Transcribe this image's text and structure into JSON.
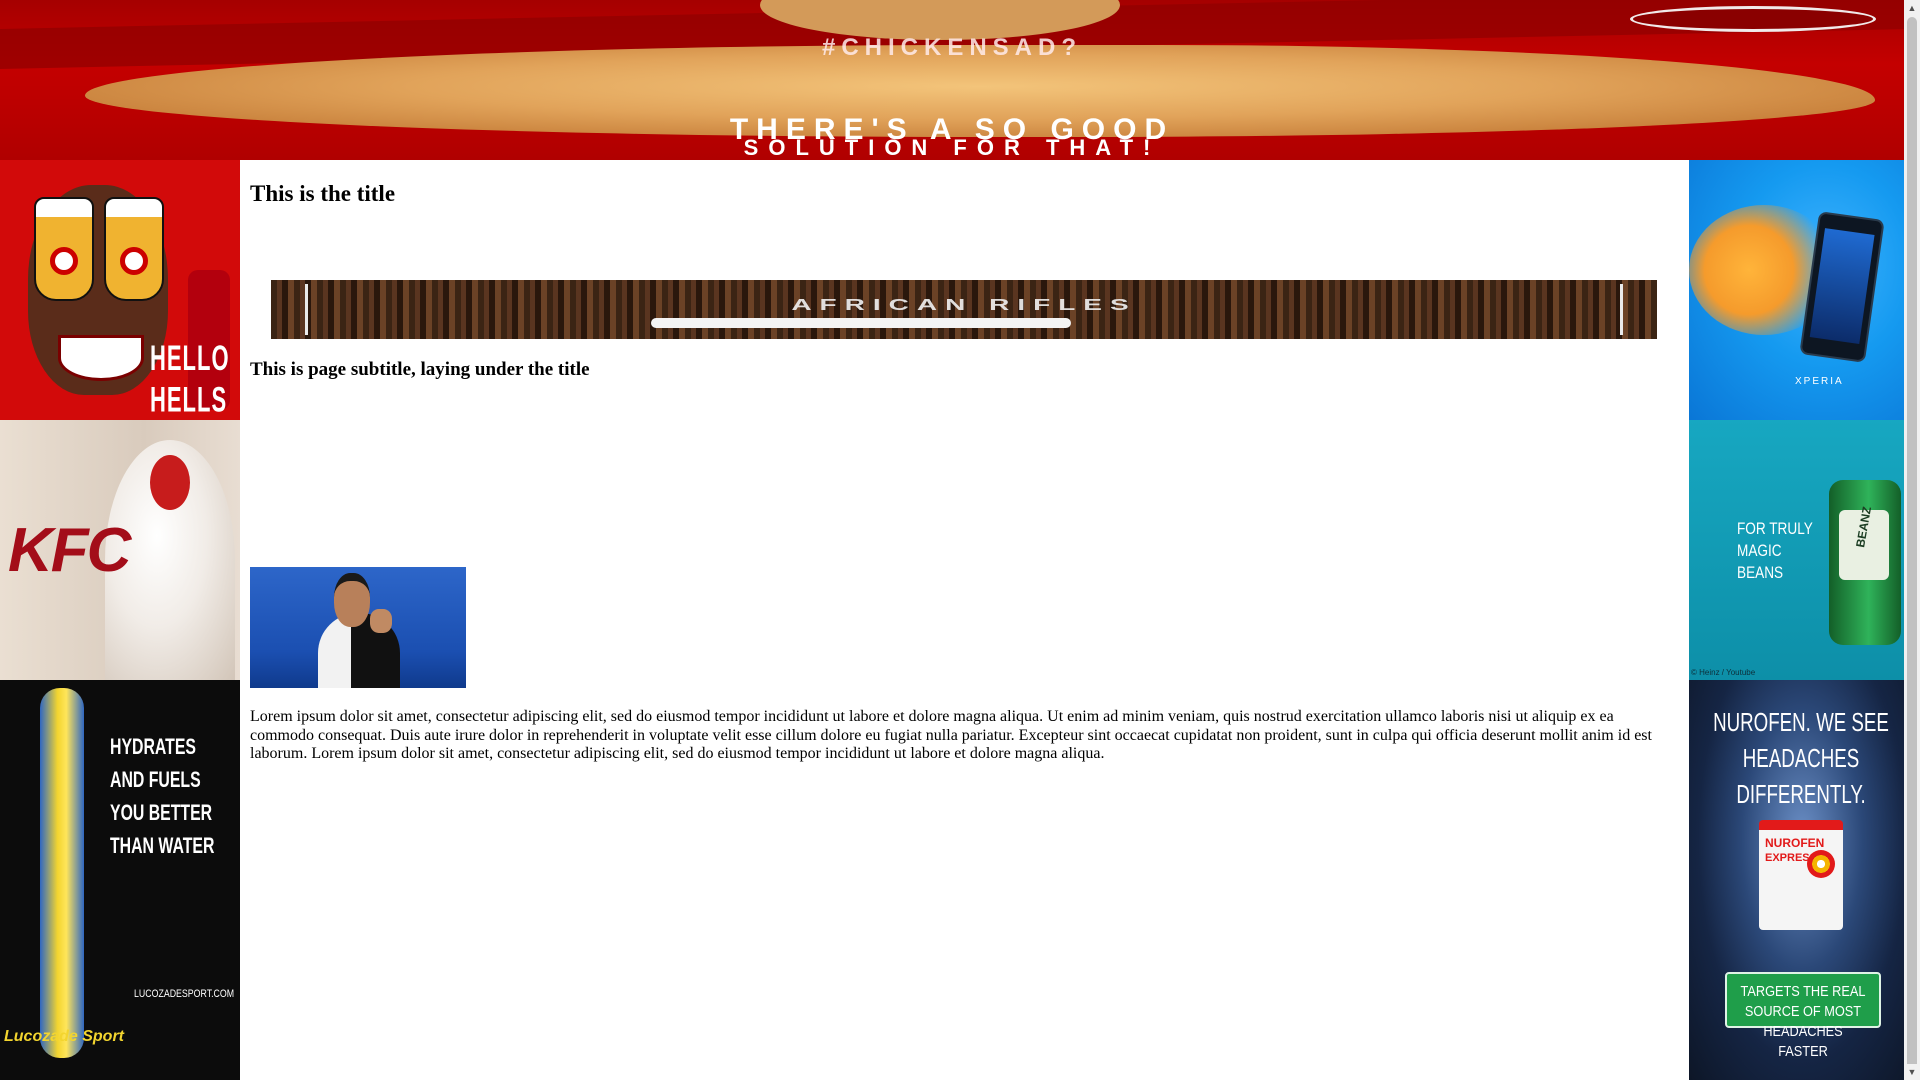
{
  "header_banner": {
    "hashtag": "#CHICKENSAD?",
    "tagline_line1": "THERE'S A SO GOOD",
    "tagline_line2": "SOLUTION FOR THAT!"
  },
  "main": {
    "title": "This is the title",
    "banner_text": "AFRICAN RIFLES",
    "subtitle": "This is page subtitle, laying under the title",
    "body_text": "Lorem ipsum dolor sit amet, consectetur adipiscing elit, sed do eiusmod tempor incididunt ut labore et dolore magna aliqua. Ut enim ad minim veniam, quis nostrud exercitation ullamco laboris nisi ut aliquip ex ea commodo consequat. Duis aute irure dolor in reprehenderit in voluptate velit esse cillum dolore eu fugiat nulla pariatur. Excepteur sint occaecat cupidatat non proident, sunt in culpa qui officia deserunt mollit anim id est laborum. Lorem ipsum dolor sit amet, consectetur adipiscing elit, sed do eiusmod tempor incididunt ut labore et dolore magna aliqua."
  },
  "left_ads": {
    "hellmanns": {
      "text": "HELLO HELLS"
    },
    "kfc": {
      "logo": "KFC"
    },
    "lucozade": {
      "copy": "HYDRATES AND FUELS YOU BETTER THAN WATER",
      "url": "LUCOZADESPORT.COM",
      "brand": "Lucozade Sport"
    }
  },
  "right_ads": {
    "xperia": {
      "brand": "XPERIA"
    },
    "heinz": {
      "copy": "FOR TRULY MAGIC BEANS",
      "can_label": "BEANZ",
      "credit": "© Heinz / Youtube"
    },
    "nurofen": {
      "headline": "NUROFEN. WE SEE HEADACHES DIFFERENTLY.",
      "pack_brand": "NUROFEN",
      "pack_sub": "EXPRESS",
      "cta": "TARGETS THE REAL SOURCE OF MOST HEADACHES FASTER"
    }
  },
  "scrollbar": {
    "up_arrow": "▲",
    "down_arrow": "▼"
  },
  "colors": {
    "banner_red": "#c40000",
    "xperia_blue": "#159af0",
    "heinz_teal": "#17a7c1",
    "cta_green": "#1f9e4a"
  }
}
